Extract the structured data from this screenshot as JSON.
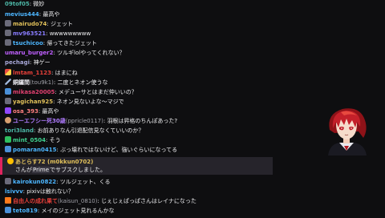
{
  "messages": [
    {
      "user": "09tof05",
      "color": "#4db6a6",
      "text": "微妙"
    },
    {
      "user": "mevius444",
      "color": "#4db6ff",
      "text": "最高や"
    },
    {
      "user": "mairudo74",
      "color": "#e0c05a",
      "text": "ジェット",
      "badge": "b-cat"
    },
    {
      "user": "mv963521",
      "color": "#8a7dff",
      "text": "wwwwwwwww",
      "badge": "b-cat"
    },
    {
      "user": "tsuchicoo",
      "color": "#4db6ff",
      "text": "帰ってきたジェット",
      "badge": "b-cat"
    },
    {
      "user": "umaru_burger2",
      "color": "#c060ff",
      "text": "ツルギlolやってくれない？"
    },
    {
      "user": "pechagi",
      "color": "#a8a8d8",
      "text": "神ゲー"
    },
    {
      "user": "lmtam_1123",
      "color": "#e8403a",
      "text": "はまにね",
      "badge": "b-sword"
    },
    {
      "user": "銅鑼問",
      "sub": "(tou9k1)",
      "color": "#e8e8ee",
      "text": "二度とネオン使うな",
      "badge": "b-blade"
    },
    {
      "user": "mikasa20005",
      "color": "#e04070",
      "text": "メデューサとはまだ仲いいの？",
      "badge": "b-sub"
    },
    {
      "user": "yagichan925",
      "color": "#e0c05a",
      "text": "ネオン見ないよな～マジで",
      "badge": "b-cat"
    },
    {
      "user": "osa_393",
      "color": "#ff8080",
      "text": "最高や",
      "badge": "b-heart"
    },
    {
      "user": "ユーエフシー死30歳",
      "sub": "(ppricle0117)",
      "color": "#b07cff",
      "text": "羽根は昇格のちんぽあった?",
      "badge": "b-char"
    },
    {
      "user": "tori3land",
      "color": "#4db6a6",
      "text": "お前ありなん引退配信見なくていいのか？"
    },
    {
      "user": "mint_0504",
      "color": "#40d090",
      "text": "そう",
      "badge": "b-green"
    },
    {
      "user": "pomaran0415",
      "color": "#4db6ff",
      "text": "ぶっ壊れではないけど、強いぐらいになってる",
      "badge": "b-sub"
    },
    {
      "user": "kairokun0822",
      "color": "#4db6ff",
      "text": "ツルジェット、くる",
      "badge": "b-cat"
    },
    {
      "user": "lsivvv",
      "color": "#4db6ff",
      "text": "pixivは触れない？"
    },
    {
      "user": "自由人の成れ果て",
      "sub": "(kaisun_0810)",
      "color": "#e8403a",
      "text": "じぇじぇぱっぱさんはレイナになった",
      "badge": "b-orange"
    },
    {
      "user": "teto819",
      "color": "#4db6ff",
      "text": "メイのジェット見れるんかな",
      "badge": "b-sub"
    }
  ],
  "sub_alert": {
    "user": "あとらす72 (m0kkun0702)",
    "text_before": "さんが",
    "mention": "Prime",
    "text_after": "でサブスクしました。"
  }
}
